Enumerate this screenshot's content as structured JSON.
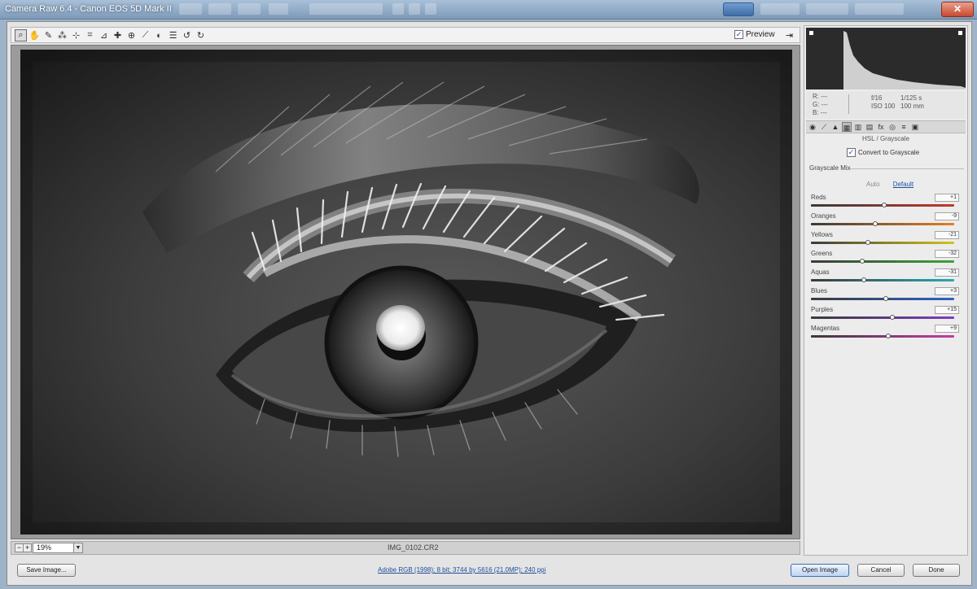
{
  "window": {
    "title": "Camera Raw 6.4  -  Canon EOS 5D Mark II"
  },
  "toolbar": {
    "tools": [
      {
        "name": "zoom-tool-icon",
        "glyph": "⌕",
        "active": true
      },
      {
        "name": "hand-tool-icon",
        "glyph": "✋"
      },
      {
        "name": "white-balance-tool-icon",
        "glyph": "✎"
      },
      {
        "name": "color-sampler-tool-icon",
        "glyph": "⁂"
      },
      {
        "name": "targeted-adjustment-tool-icon",
        "glyph": "⊹"
      },
      {
        "name": "crop-tool-icon",
        "glyph": "⌗"
      },
      {
        "name": "straighten-tool-icon",
        "glyph": "⊿"
      },
      {
        "name": "spot-removal-tool-icon",
        "glyph": "✚"
      },
      {
        "name": "red-eye-removal-tool-icon",
        "glyph": "⊕"
      },
      {
        "name": "adjustment-brush-icon",
        "glyph": "⟋"
      },
      {
        "name": "graduated-filter-icon",
        "glyph": "◐"
      },
      {
        "name": "preferences-icon",
        "glyph": "☰"
      },
      {
        "name": "rotate-left-icon",
        "glyph": "↺"
      },
      {
        "name": "rotate-right-icon",
        "glyph": "↻"
      }
    ],
    "preview_label": "Preview",
    "preview_checked": true
  },
  "statusbar": {
    "zoom_value": "19%",
    "filename": "IMG_0102.CR2"
  },
  "panel": {
    "readout": {
      "r": "R:  ---",
      "g": "G:  ---",
      "b": "B:  ---",
      "aperture": "f/16",
      "shutter": "1/125 s",
      "iso": "ISO 100",
      "focal": "100 mm"
    },
    "section_title": "HSL / Grayscale",
    "convert_label": "Convert to Grayscale",
    "convert_checked": true,
    "mix_label": "Grayscale Mix",
    "auto_label": "Auto",
    "default_label": "Default",
    "sliders": [
      {
        "label": "Reds",
        "value": "+1",
        "pos": 0.51,
        "track": "linear-gradient(to right,#3a3a3a,#c0392b)"
      },
      {
        "label": "Oranges",
        "value": "-9",
        "pos": 0.45,
        "track": "linear-gradient(to right,#3a3a3a,#e67e22)"
      },
      {
        "label": "Yellows",
        "value": "-21",
        "pos": 0.4,
        "track": "linear-gradient(to right,#3a3a3a,#d4c21a)"
      },
      {
        "label": "Greens",
        "value": "-32",
        "pos": 0.36,
        "track": "linear-gradient(to right,#3a3a3a,#3ea43a)"
      },
      {
        "label": "Aquas",
        "value": "-31",
        "pos": 0.37,
        "track": "linear-gradient(to right,#3a3a3a,#29a9b5)"
      },
      {
        "label": "Blues",
        "value": "+3",
        "pos": 0.52,
        "track": "linear-gradient(to right,#3a3a3a,#2d63c4)"
      },
      {
        "label": "Purples",
        "value": "+15",
        "pos": 0.57,
        "track": "linear-gradient(to right,#3a3a3a,#7b3fbf)"
      },
      {
        "label": "Magentas",
        "value": "+9",
        "pos": 0.54,
        "track": "linear-gradient(to right,#3a3a3a,#c23ca4)"
      }
    ]
  },
  "footer": {
    "save_label": "Save Image...",
    "workflow_label": "Adobe RGB (1998); 8 bit; 3744 by 5616 (21.0MP); 240 ppi",
    "open_label": "Open Image",
    "cancel_label": "Cancel",
    "done_label": "Done"
  },
  "colors": {
    "accent": "#1d4f9a",
    "titlebar": "#7d9ab8",
    "dialog_bg": "#e4e4e4"
  }
}
